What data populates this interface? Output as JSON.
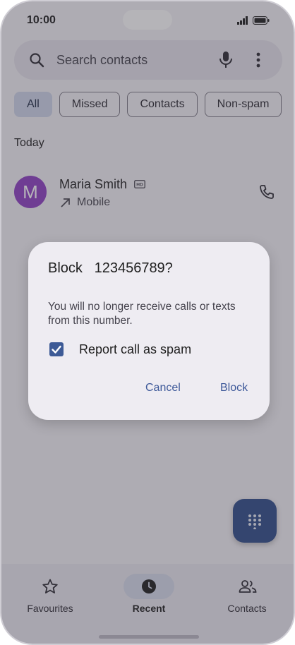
{
  "status_bar": {
    "time": "10:00"
  },
  "search": {
    "placeholder": "Search contacts"
  },
  "filters": [
    {
      "label": "All",
      "selected": true
    },
    {
      "label": "Missed",
      "selected": false
    },
    {
      "label": "Contacts",
      "selected": false
    },
    {
      "label": "Non-spam",
      "selected": false
    }
  ],
  "section": {
    "label": "Today"
  },
  "call_log": [
    {
      "initial": "M",
      "name": "Maria Smith",
      "type": "Mobile",
      "avatar_color": "#8e3fc4"
    }
  ],
  "dialog": {
    "title": "Block   123456789?",
    "body": "You will no longer receive calls or texts from this number.",
    "checkbox_label": "Report call as spam",
    "checkbox_checked": true,
    "cancel_label": "Cancel",
    "confirm_label": "Block"
  },
  "bottom_nav": [
    {
      "label": "Favourites",
      "icon": "star-icon",
      "active": false
    },
    {
      "label": "Recent",
      "icon": "clock-icon",
      "active": true
    },
    {
      "label": "Contacts",
      "icon": "people-icon",
      "active": false
    }
  ],
  "colors": {
    "accent": "#3f5a9a",
    "fab": "#2f4d8a",
    "avatar": "#8e3fc4"
  }
}
